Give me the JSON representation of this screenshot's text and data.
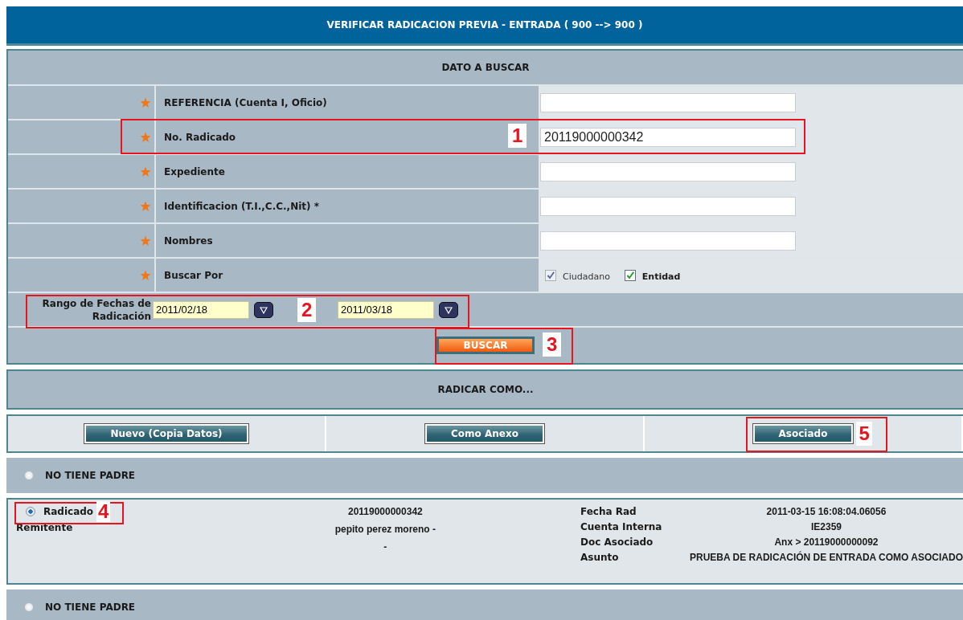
{
  "title": "VERIFICAR RADICACION PREVIA - ENTRADA ( 900 --> 900 )",
  "search": {
    "heading": "DATO A BUSCAR",
    "fields": [
      {
        "label": "REFERENCIA (Cuenta I, Oficio)"
      },
      {
        "label": "No. Radicado",
        "value": "20119000000342",
        "callout": "1"
      },
      {
        "label": "Expediente"
      },
      {
        "label": "Identificacion (T.I.,C.C.,Nit) *"
      },
      {
        "label": "Nombres"
      }
    ],
    "buscar_por": {
      "label": "Buscar Por",
      "options": [
        {
          "label": "Ciudadano",
          "checked": true,
          "disabled": true
        },
        {
          "label": "Entidad",
          "checked": true,
          "disabled": false
        }
      ]
    },
    "date_range": {
      "label": "Rango de Fechas de Radicación",
      "from": "2011/02/18",
      "to": "2011/03/18",
      "callout": "2"
    },
    "button": {
      "label": "BUSCAR",
      "callout": "3"
    }
  },
  "radicar": {
    "heading": "RADICAR COMO...",
    "buttons": [
      {
        "label": "Nuevo (Copia Datos)"
      },
      {
        "label": "Como Anexo"
      },
      {
        "label": "Asociado",
        "callout": "5"
      }
    ]
  },
  "parents": [
    {
      "kind": "none",
      "label": "NO TIENE PADRE",
      "selected": false
    },
    {
      "kind": "record",
      "label": "Radicado",
      "selected": true,
      "callout": "4",
      "number": "20119000000342",
      "remitente_label": "Remitente",
      "remitente": "pepito perez moreno -",
      "extra": "-",
      "details": [
        {
          "label": "Fecha Rad",
          "value": "2011-03-15 16:08:04.06056"
        },
        {
          "label": "Cuenta Interna",
          "value": "IE2359"
        },
        {
          "label": "Doc Asociado",
          "value": "Anx > 20119000000092"
        },
        {
          "label": "Asunto",
          "value": "PRUEBA DE RADICACIÓN DE ENTRADA COMO ASOCIADO"
        }
      ]
    },
    {
      "kind": "none",
      "label": "NO TIENE PADRE",
      "selected": false
    }
  ]
}
